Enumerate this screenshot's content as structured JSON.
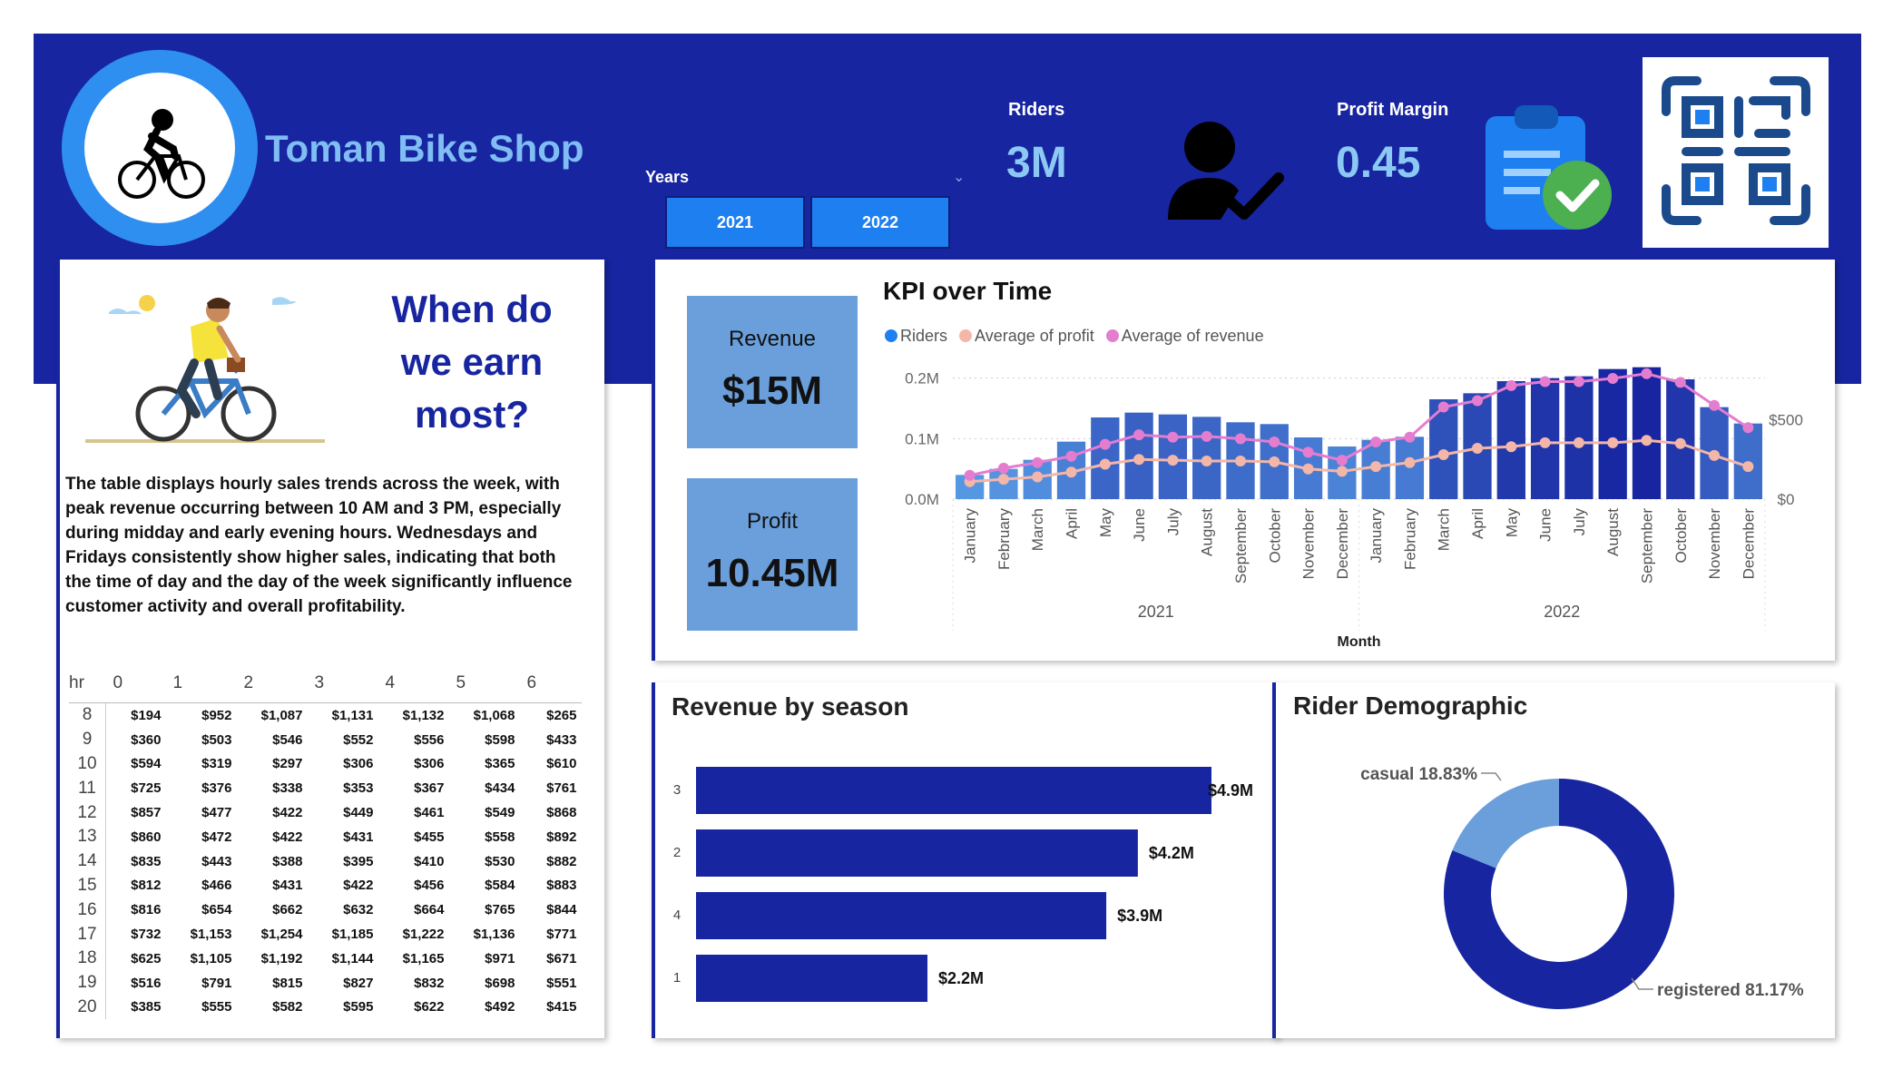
{
  "header": {
    "title": "Toman Bike Shop",
    "years_label": "Years",
    "year_buttons": [
      "2021",
      "2022"
    ],
    "riders_label": "Riders",
    "riders_value": "3M",
    "profit_margin_label": "Profit Margin",
    "profit_margin_value": "0.45"
  },
  "left_panel": {
    "question": "When do we earn most?",
    "description": "The table displays hourly sales trends across the week, with peak revenue occurring between 10 AM and 3 PM, especially during midday and early evening hours. Wednesdays and Fridays consistently show higher sales, indicating that both the time of day and the day of the week significantly influence customer activity and overall profitability.",
    "table": {
      "header": [
        "hr",
        "0",
        "1",
        "2",
        "3",
        "4",
        "5",
        "6"
      ],
      "rows": [
        [
          "8",
          "$194",
          "$952",
          "$1,087",
          "$1,131",
          "$1,132",
          "$1,068",
          "$265"
        ],
        [
          "9",
          "$360",
          "$503",
          "$546",
          "$552",
          "$556",
          "$598",
          "$433"
        ],
        [
          "10",
          "$594",
          "$319",
          "$297",
          "$306",
          "$306",
          "$365",
          "$610"
        ],
        [
          "11",
          "$725",
          "$376",
          "$338",
          "$353",
          "$367",
          "$434",
          "$761"
        ],
        [
          "12",
          "$857",
          "$477",
          "$422",
          "$449",
          "$461",
          "$549",
          "$868"
        ],
        [
          "13",
          "$860",
          "$472",
          "$422",
          "$431",
          "$455",
          "$558",
          "$892"
        ],
        [
          "14",
          "$835",
          "$443",
          "$388",
          "$395",
          "$410",
          "$530",
          "$882"
        ],
        [
          "15",
          "$812",
          "$466",
          "$431",
          "$422",
          "$456",
          "$584",
          "$883"
        ],
        [
          "16",
          "$816",
          "$654",
          "$662",
          "$632",
          "$664",
          "$765",
          "$844"
        ],
        [
          "17",
          "$732",
          "$1,153",
          "$1,254",
          "$1,185",
          "$1,222",
          "$1,136",
          "$771"
        ],
        [
          "18",
          "$625",
          "$1,105",
          "$1,192",
          "$1,144",
          "$1,165",
          "$971",
          "$671"
        ],
        [
          "19",
          "$516",
          "$791",
          "$815",
          "$827",
          "$832",
          "$698",
          "$551"
        ],
        [
          "20",
          "$385",
          "$555",
          "$582",
          "$595",
          "$622",
          "$492",
          "$415"
        ]
      ]
    }
  },
  "kpi_cards": {
    "revenue_label": "Revenue",
    "revenue_value": "$15M",
    "profit_label": "Profit",
    "profit_value": "10.45M"
  },
  "chart_data": [
    {
      "type": "bar",
      "title": "KPI over Time",
      "xlabel": "Month",
      "legend": [
        "Riders",
        "Average of profit",
        "Average of revenue"
      ],
      "categories": [
        "January",
        "February",
        "March",
        "April",
        "May",
        "June",
        "July",
        "August",
        "September",
        "October",
        "November",
        "December",
        "January",
        "February",
        "March",
        "April",
        "May",
        "June",
        "July",
        "August",
        "September",
        "October",
        "November",
        "December"
      ],
      "year_groups": [
        "2021",
        "2022"
      ],
      "y_left_ticks": [
        "0.0M",
        "0.1M",
        "0.2M"
      ],
      "y_right_ticks": [
        "$0",
        "$500"
      ],
      "ylim": [
        0,
        0.24
      ],
      "y2lim": [
        0,
        1000
      ],
      "series": [
        {
          "name": "Riders",
          "type": "bar",
          "values": [
            0.04,
            0.05,
            0.065,
            0.095,
            0.135,
            0.143,
            0.14,
            0.136,
            0.127,
            0.124,
            0.102,
            0.087,
            0.098,
            0.103,
            0.165,
            0.175,
            0.195,
            0.2,
            0.203,
            0.215,
            0.218,
            0.198,
            0.152,
            0.125
          ]
        },
        {
          "name": "Average of profit",
          "type": "line",
          "values": [
            110,
            125,
            140,
            170,
            220,
            250,
            245,
            240,
            240,
            235,
            190,
            175,
            205,
            230,
            280,
            320,
            330,
            355,
            355,
            355,
            370,
            350,
            275,
            205
          ]
        },
        {
          "name": "Average of revenue",
          "type": "line",
          "values": [
            150,
            195,
            230,
            270,
            345,
            405,
            390,
            395,
            380,
            360,
            295,
            245,
            360,
            390,
            580,
            620,
            715,
            740,
            740,
            760,
            790,
            735,
            590,
            450
          ]
        }
      ],
      "colors": {
        "bar_light": "#5b9fe8",
        "bar_dark": "#1725a0",
        "profit": "#f4b6a8",
        "revenue": "#e47dd0",
        "riders_legend": "#1e7ff0"
      }
    },
    {
      "type": "bar",
      "title": "Revenue by season",
      "orientation": "horizontal",
      "categories": [
        "3",
        "2",
        "4",
        "1"
      ],
      "values": [
        4.9,
        4.2,
        3.9,
        2.2
      ],
      "labels": [
        "$4.9M",
        "$4.2M",
        "$3.9M",
        "$2.2M"
      ],
      "color": "#1725a0"
    },
    {
      "type": "pie",
      "title": "Rider Demographic",
      "slices": [
        {
          "label": "casual 18.83%",
          "value": 18.83,
          "color": "#6a9fdb"
        },
        {
          "label": "registered 81.17%",
          "value": 81.17,
          "color": "#1725a0"
        }
      ]
    }
  ]
}
